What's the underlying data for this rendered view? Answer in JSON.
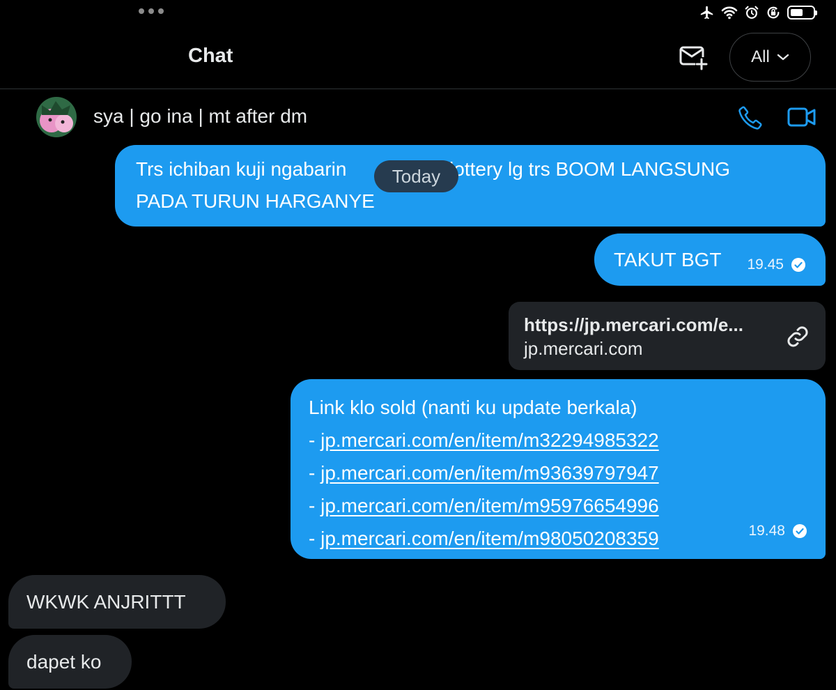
{
  "header": {
    "title": "Chat",
    "filter_label": "All"
  },
  "conversation": {
    "name": "sya | go ina | mt after dm"
  },
  "date_separator": "Today",
  "messages": [
    {
      "direction": "outgoing",
      "lines": [
        "Trs ichiban kuji ngabarin",
        "la lottery lg trs BOOM LANGSUNG",
        "PADA TURUN HARGANYE"
      ]
    },
    {
      "direction": "outgoing",
      "text": "TAKUT BGT",
      "time": "19.45"
    },
    {
      "direction": "outgoing",
      "type": "link-card",
      "title": "https://jp.mercari.com/e...",
      "domain": "jp.mercari.com"
    },
    {
      "direction": "outgoing",
      "intro": "Link klo sold (nanti ku update berkala)",
      "links": [
        "jp.mercari.com/en/item/m32294985322",
        "jp.mercari.com/en/item/m93639797947",
        "jp.mercari.com/en/item/m95976654996",
        "jp.mercari.com/en/item/m98050208359"
      ],
      "time": "19.48"
    },
    {
      "direction": "incoming",
      "text": "WKWK ANJRITTT"
    },
    {
      "direction": "incoming",
      "text": "dapet ko"
    }
  ],
  "colors": {
    "background": "#000000",
    "outgoing_bubble": "#1d9bf0",
    "incoming_bubble": "#202327",
    "accent": "#1d9bf0"
  },
  "icons": [
    "more-dots-icon",
    "airplane-icon",
    "wifi-icon",
    "alarm-icon",
    "orientation-lock-icon",
    "battery-icon",
    "new-message-icon",
    "chevron-down-icon",
    "phone-icon",
    "video-icon",
    "link-icon",
    "sent-check-icon"
  ]
}
